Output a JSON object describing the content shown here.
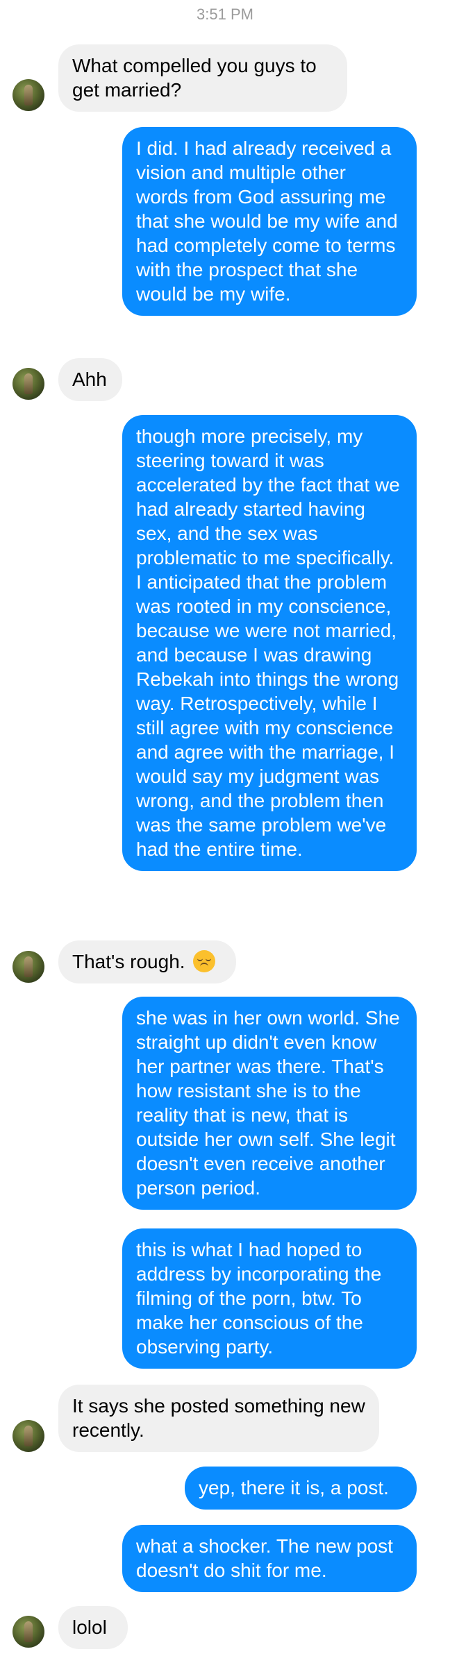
{
  "conversation": {
    "timestamp": "3:51 PM",
    "messages": [
      {
        "sender": "them",
        "text": "What compelled you guys to get married?"
      },
      {
        "sender": "me",
        "text": "I did. I had already received a vision and multiple other words from God assuring me that she would be my wife and had completely come to terms with the prospect that she would be my wife."
      },
      {
        "sender": "them",
        "text": "Ahh"
      },
      {
        "sender": "me",
        "text": "though more precisely, my steering toward it was accelerated by the fact that we had already started having sex, and the sex was problematic to me specifically. I anticipated that the problem was rooted in my conscience, because we were not married, and because I was drawing Rebekah into things the wrong way. Retrospectively, while I still agree with my conscience and agree with the marriage, I would say my judgment was wrong, and the problem then was the same problem we've had the entire time."
      },
      {
        "sender": "them",
        "text": "That's rough.",
        "emoji": "disappointed-face"
      },
      {
        "sender": "me",
        "text": "she was in her own world. She straight up didn't even know her partner was there. That's how resistant she is to the reality that is new, that is outside her own self. She legit doesn't even receive another person period."
      },
      {
        "sender": "me",
        "text": "this is what I had hoped to address by incorporating the filming of the porn, btw. To make her conscious of the observing party."
      },
      {
        "sender": "them",
        "text": "It says she posted something new recently."
      },
      {
        "sender": "me",
        "text": "yep, there it is, a post."
      },
      {
        "sender": "me",
        "text": "what a shocker. The new post doesn't do shit for me."
      },
      {
        "sender": "them",
        "text": "lolol"
      }
    ]
  },
  "colors": {
    "outgoing_bubble": "#0a8cff",
    "incoming_bubble": "#f0f0f0",
    "timestamp_text": "#9b9b9b"
  }
}
